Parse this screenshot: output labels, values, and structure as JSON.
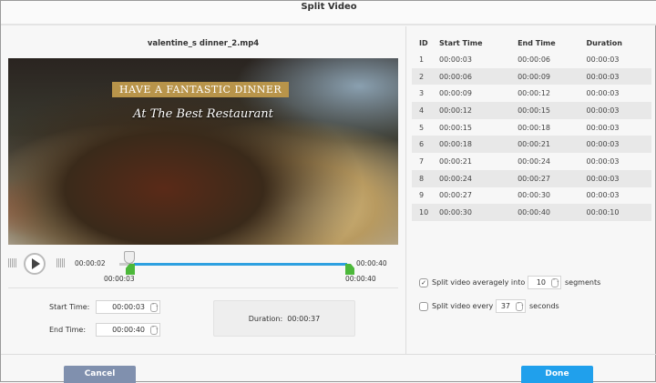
{
  "title": "Split Video",
  "filename": "valentine_s dinner_2.mp4",
  "video": {
    "banner": "HAVE A FANTASTIC DINNER",
    "tagline": "At The Best Restaurant"
  },
  "player": {
    "current_time": "00:00:02",
    "start_marker": "00:00:03",
    "end_marker": "00:00:40",
    "end_label": "00:00:40"
  },
  "form": {
    "start_label": "Start Time:",
    "start_value": "00:00:03",
    "end_label": "End Time:",
    "end_value": "00:00:40",
    "duration_label": "Duration:",
    "duration_value": "00:00:37"
  },
  "table": {
    "headers": [
      "ID",
      "Start Time",
      "End Time",
      "Duration"
    ],
    "rows": [
      [
        "1",
        "00:00:03",
        "00:00:06",
        "00:00:03"
      ],
      [
        "2",
        "00:00:06",
        "00:00:09",
        "00:00:03"
      ],
      [
        "3",
        "00:00:09",
        "00:00:12",
        "00:00:03"
      ],
      [
        "4",
        "00:00:12",
        "00:00:15",
        "00:00:03"
      ],
      [
        "5",
        "00:00:15",
        "00:00:18",
        "00:00:03"
      ],
      [
        "6",
        "00:00:18",
        "00:00:21",
        "00:00:03"
      ],
      [
        "7",
        "00:00:21",
        "00:00:24",
        "00:00:03"
      ],
      [
        "8",
        "00:00:24",
        "00:00:27",
        "00:00:03"
      ],
      [
        "9",
        "00:00:27",
        "00:00:30",
        "00:00:03"
      ],
      [
        "10",
        "00:00:30",
        "00:00:40",
        "00:00:10"
      ]
    ]
  },
  "options": {
    "avg_label": "Split video averagely into",
    "avg_value": "10",
    "avg_unit": "segments",
    "avg_checked": true,
    "every_label": "Split video every",
    "every_value": "37",
    "every_unit": "seconds",
    "every_checked": false
  },
  "buttons": {
    "cancel": "Cancel",
    "done": "Done"
  }
}
